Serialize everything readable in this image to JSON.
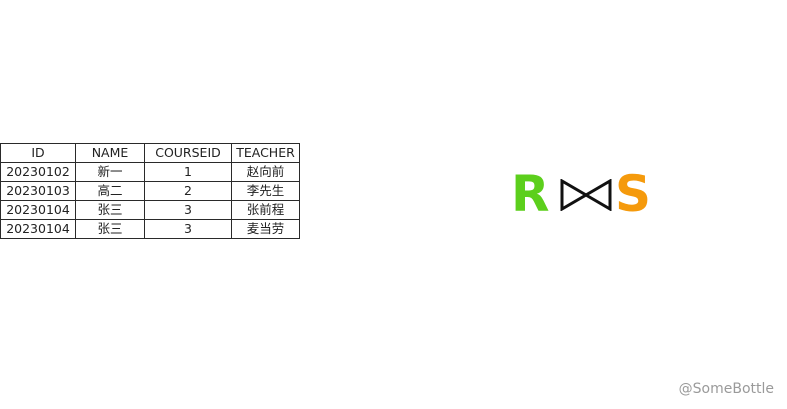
{
  "table": {
    "headers": [
      "ID",
      "NAME",
      "COURSEID",
      "TEACHER"
    ],
    "rows": [
      [
        "20230102",
        "新一",
        "1",
        "赵向前"
      ],
      [
        "20230103",
        "高二",
        "2",
        "李先生"
      ],
      [
        "20230104",
        "张三",
        "3",
        "张前程"
      ],
      [
        "20230104",
        "张三",
        "3",
        "麦当劳"
      ]
    ]
  },
  "join": {
    "left_relation": "R",
    "right_relation": "S",
    "operator_icon": "natural-join-icon",
    "left_color": "#5ccf1c",
    "right_color": "#f59a0c",
    "operator_color": "#111111"
  },
  "watermark": "@SomeBottle"
}
